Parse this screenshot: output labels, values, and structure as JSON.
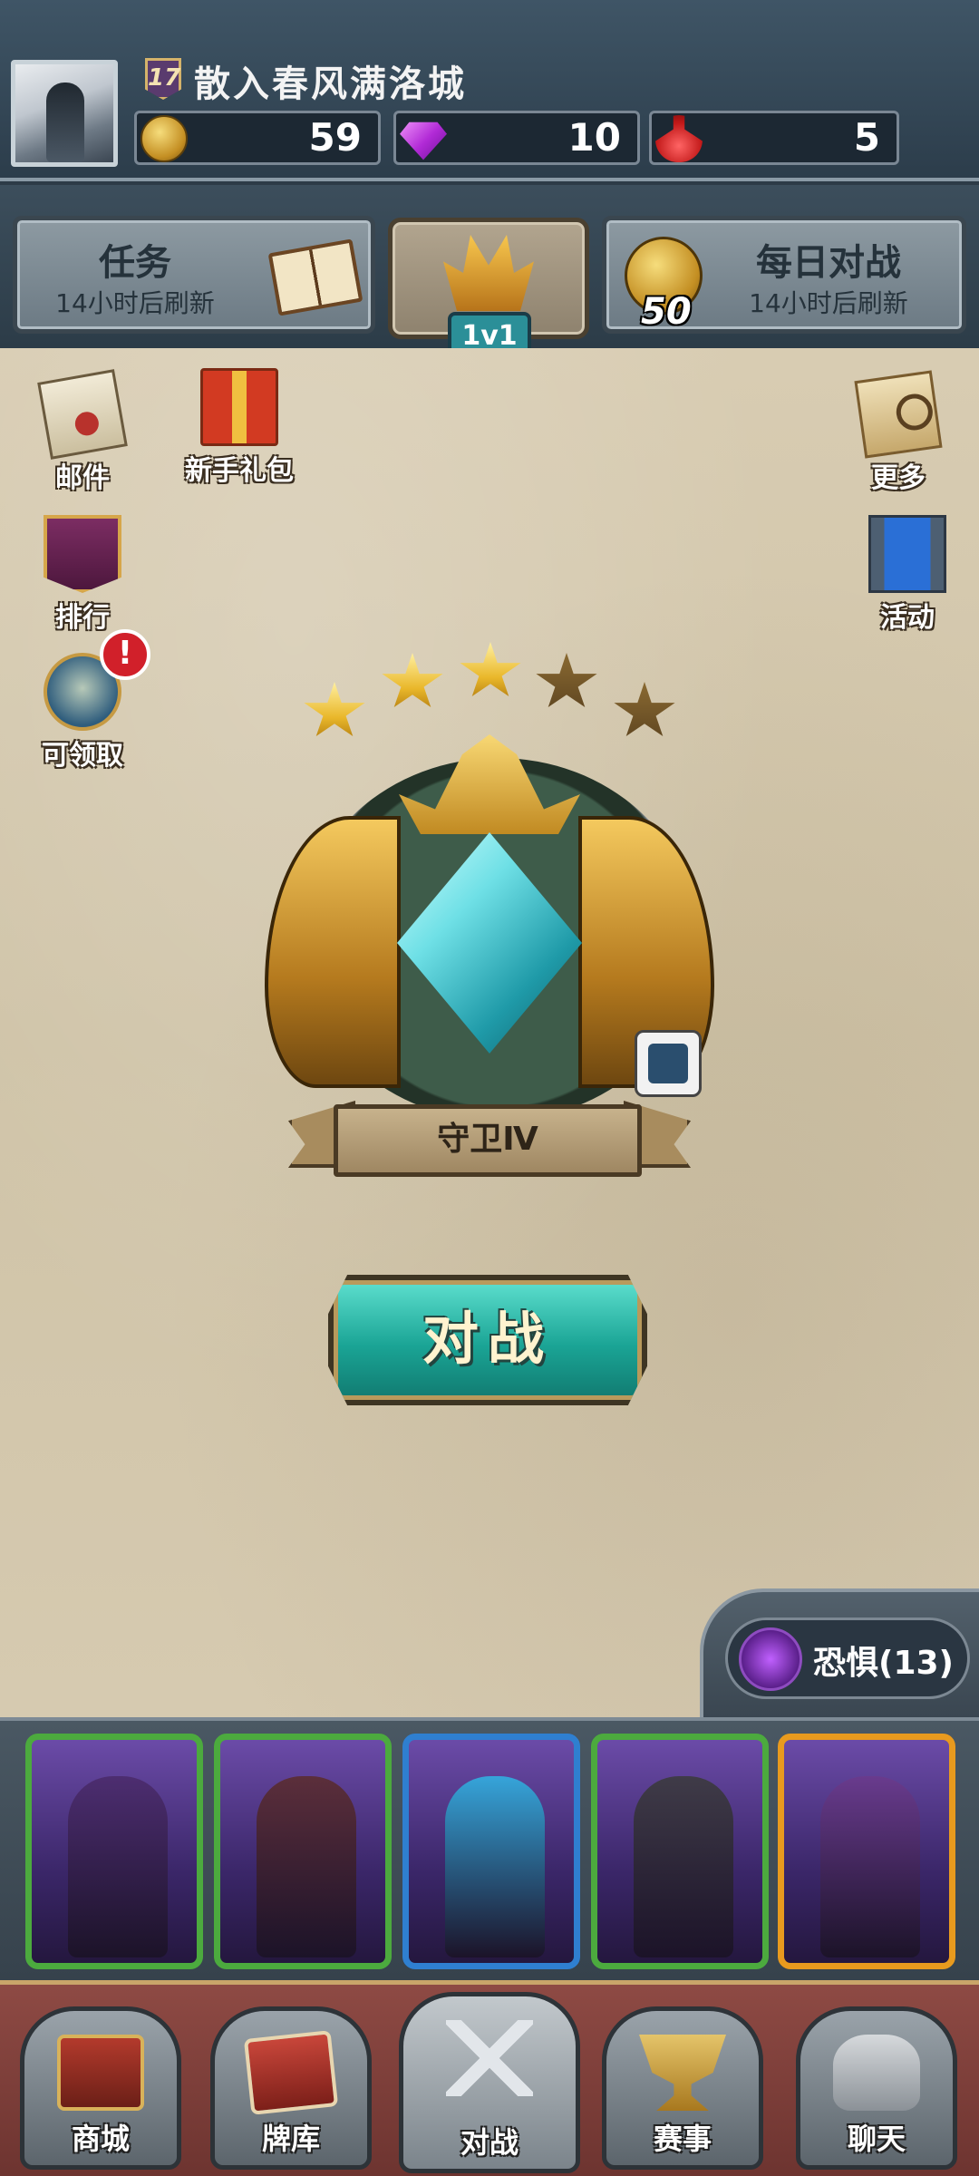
{
  "header": {
    "level": "17",
    "username": "散入春风满洛城",
    "resources": [
      {
        "icon": "coin-icon",
        "value": "59"
      },
      {
        "icon": "gem-icon",
        "value": "10"
      },
      {
        "icon": "potion-icon",
        "value": "5"
      }
    ]
  },
  "modes": {
    "tasks": {
      "title": "任务",
      "subtitle": "14小时后刷新"
    },
    "center": {
      "badge": "1v1"
    },
    "daily": {
      "title": "每日对战",
      "subtitle": "14小时后刷新",
      "coin_amount": "50"
    }
  },
  "side_menu": {
    "mail": "邮件",
    "newbie_gift": "新手礼包",
    "more": "更多",
    "ranking": "排行",
    "events": "活动",
    "claimable": "可领取",
    "alert_mark": "!"
  },
  "rank": {
    "stars_total": 5,
    "stars_filled": 3,
    "name": "守卫Ⅳ"
  },
  "battle_button": "对战",
  "faction": {
    "label": "恐惧(13)"
  },
  "cards": [
    {
      "frame": "#4caa3e",
      "art": "#4a2a6a"
    },
    {
      "frame": "#4caa3e",
      "art": "#5b2b2b"
    },
    {
      "frame": "#2f7fd0",
      "art": "#2fb6e6"
    },
    {
      "frame": "#4caa3e",
      "art": "#3a3a3a"
    },
    {
      "frame": "#e89a1e",
      "art": "#6b3a8c"
    }
  ],
  "bottom_nav": [
    {
      "label": "商城",
      "icon": "shop-icon"
    },
    {
      "label": "牌库",
      "icon": "deck-icon"
    },
    {
      "label": "对战",
      "icon": "battle-icon"
    },
    {
      "label": "赛事",
      "icon": "trophy-icon"
    },
    {
      "label": "聊天",
      "icon": "chat-icon"
    }
  ]
}
